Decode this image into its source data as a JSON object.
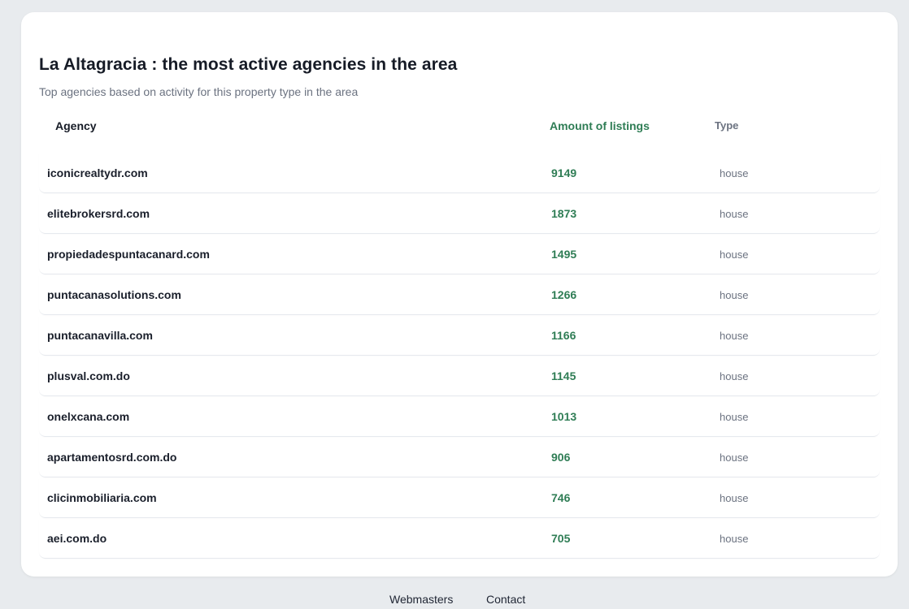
{
  "header": {
    "title": "La Altagracia : the most active agencies in the area",
    "subtitle": "Top agencies based on activity for this property type in the area"
  },
  "table": {
    "columns": [
      "Agency",
      "Amount of listings",
      "Type"
    ],
    "rows": [
      {
        "agency": "iconicrealtydr.com",
        "amount": "9149",
        "type": "house"
      },
      {
        "agency": "elitebrokersrd.com",
        "amount": "1873",
        "type": "house"
      },
      {
        "agency": "propiedadespuntacanard.com",
        "amount": "1495",
        "type": "house"
      },
      {
        "agency": "puntacanasolutions.com",
        "amount": "1266",
        "type": "house"
      },
      {
        "agency": "puntacanavilla.com",
        "amount": "1166",
        "type": "house"
      },
      {
        "agency": "plusval.com.do",
        "amount": "1145",
        "type": "house"
      },
      {
        "agency": "onelxcana.com",
        "amount": "1013",
        "type": "house"
      },
      {
        "agency": "apartamentosrd.com.do",
        "amount": "906",
        "type": "house"
      },
      {
        "agency": "clicinmobiliaria.com",
        "amount": "746",
        "type": "house"
      },
      {
        "agency": "aei.com.do",
        "amount": "705",
        "type": "house"
      }
    ]
  },
  "footer": {
    "links": [
      "Webmasters",
      "Contact"
    ]
  },
  "colors": {
    "accent": "#2f7d55",
    "background": "#e8ebee",
    "card": "#ffffff"
  }
}
